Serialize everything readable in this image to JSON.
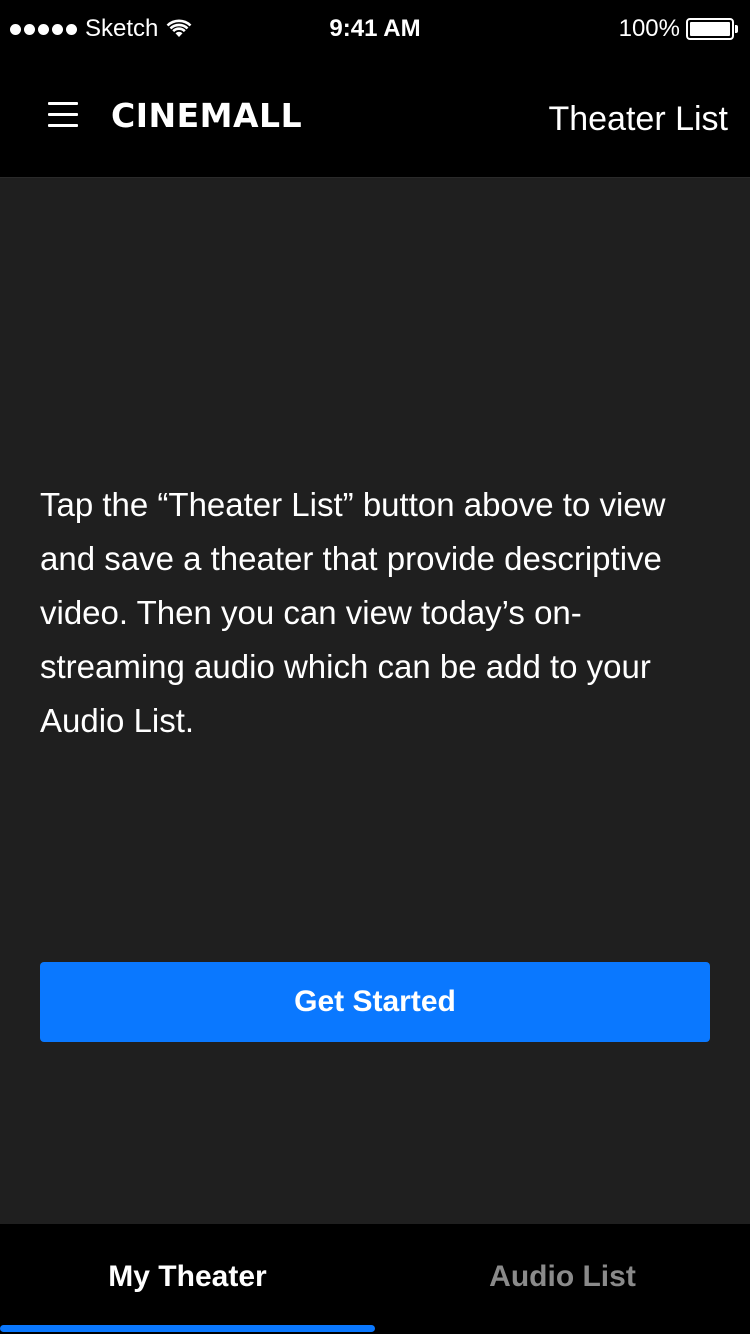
{
  "status_bar": {
    "carrier": "Sketch",
    "time": "9:41 AM",
    "battery": "100%"
  },
  "header": {
    "logo": "CINEMALL",
    "theater_list_link": "Theater List"
  },
  "main": {
    "message": "Tap the “Theater List” button above to view and save a theater that provide descriptive video. Then you can view today’s on-streaming audio which can be add to your Audio List.",
    "cta_label": "Get Started"
  },
  "tabs": [
    {
      "label": "My Theater",
      "active": true
    },
    {
      "label": "Audio List",
      "active": false
    }
  ],
  "colors": {
    "accent": "#0a78ff",
    "background": "#1f1f1f",
    "bar": "#000000",
    "inactive_tab": "#8a8a8a"
  }
}
